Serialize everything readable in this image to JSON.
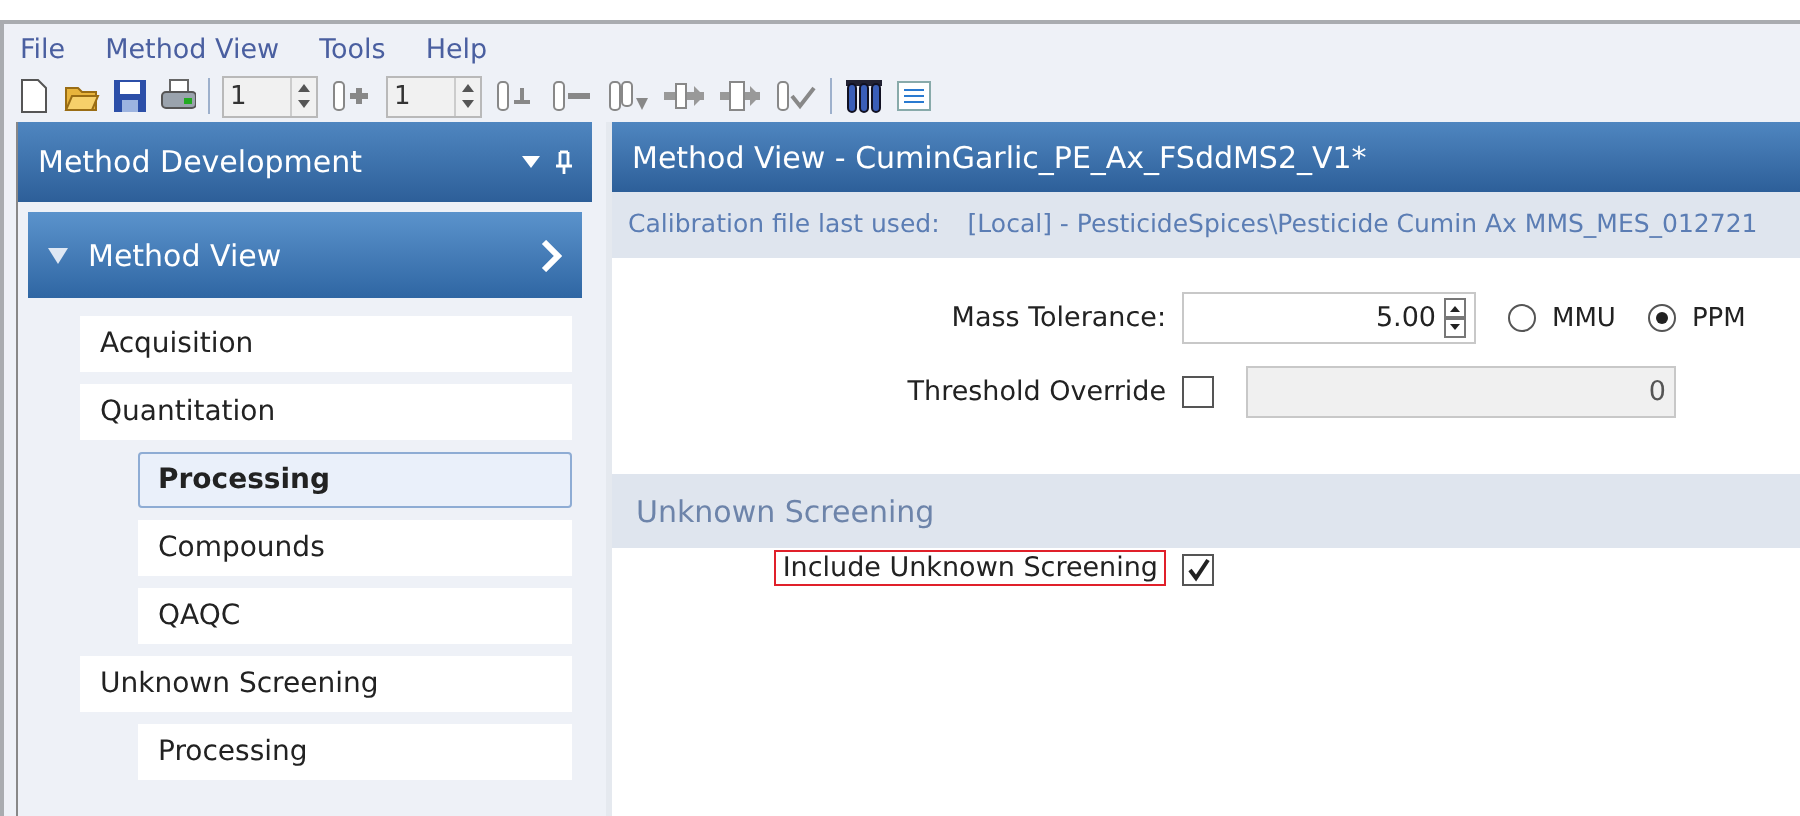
{
  "menu": [
    {
      "label": "File"
    },
    {
      "label": "Method View"
    },
    {
      "label": "Tools"
    },
    {
      "label": "Help"
    }
  ],
  "toolbar": {
    "spinners": [
      {
        "value": "1"
      },
      {
        "value": "1"
      }
    ]
  },
  "sidebar": {
    "title": "Method Development",
    "section": {
      "title": "Method View",
      "expanded": true
    },
    "items": [
      {
        "label": "Acquisition",
        "selected": false
      },
      {
        "label": "Quantitation",
        "selected": false,
        "children": [
          {
            "label": "Processing",
            "selected": true
          },
          {
            "label": "Compounds",
            "selected": false
          },
          {
            "label": "QAQC",
            "selected": false
          }
        ]
      },
      {
        "label": "Unknown Screening",
        "selected": false,
        "children": [
          {
            "label": "Processing",
            "selected": false
          }
        ]
      }
    ]
  },
  "main": {
    "title": "Method View - CuminGarlic_PE_Ax_FSddMS2_V1*",
    "calibration": {
      "label": "Calibration file last used:",
      "value": "[Local] - PesticideSpices\\Pesticide Cumin Ax MMS_MES_012721"
    },
    "mass_tolerance": {
      "label": "Mass Tolerance:",
      "value": "5.00",
      "units": [
        {
          "label": "MMU",
          "selected": false
        },
        {
          "label": "PPM",
          "selected": true
        }
      ]
    },
    "threshold_override": {
      "label": "Threshold Override",
      "checked": false,
      "value": "0",
      "disabled": true
    },
    "section": "Unknown Screening",
    "include_unknown": {
      "label": "Include Unknown Screening",
      "checked": true,
      "highlighted": true
    }
  }
}
